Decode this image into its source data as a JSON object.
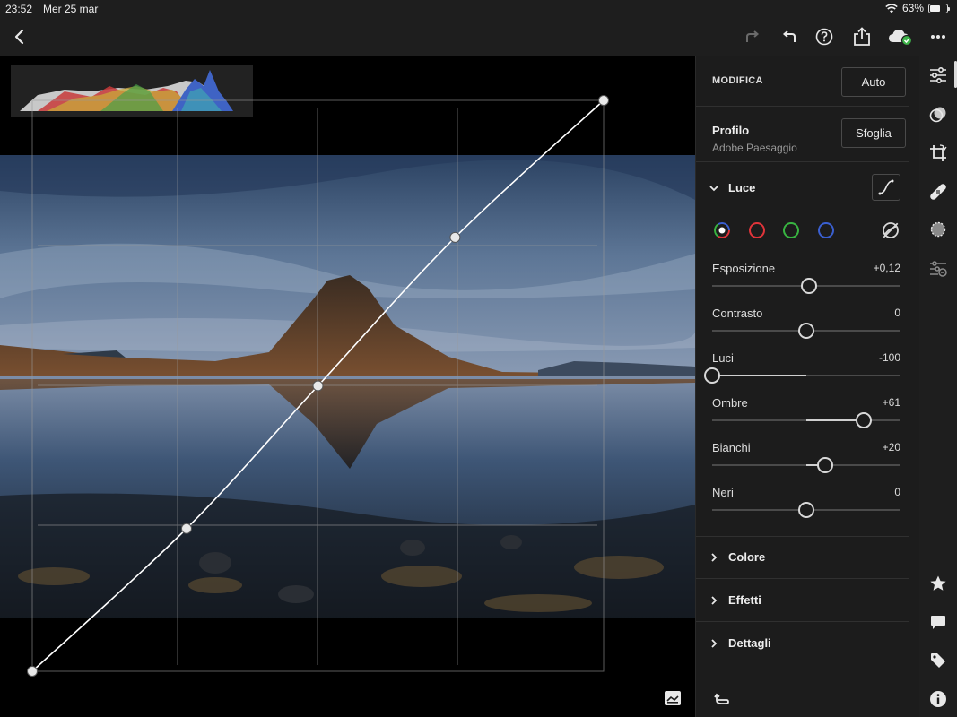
{
  "status_bar": {
    "time": "23:52",
    "date": "Mer 25 mar",
    "battery": "63%",
    "battery_level": 0.63
  },
  "toolbar": {
    "icons": [
      "back-icon",
      "redo-icon",
      "undo-icon",
      "help-icon",
      "share-icon",
      "cloud-sync-icon",
      "more-icon"
    ]
  },
  "canvas": {
    "tone_curve_points": [
      [
        0,
        0
      ],
      [
        0.27,
        0.25
      ],
      [
        0.5,
        0.5
      ],
      [
        0.74,
        0.76
      ],
      [
        1,
        1
      ]
    ]
  },
  "panel": {
    "header": "MODIFICA",
    "auto_label": "Auto",
    "profile": {
      "title": "Profilo",
      "value": "Adobe Paesaggio",
      "browse_label": "Sfoglia"
    },
    "light": {
      "title": "Luce",
      "channels": [
        {
          "name": "rgb-channel-icon",
          "color": "#ffffff"
        },
        {
          "name": "red-channel-icon",
          "color": "#e0343a"
        },
        {
          "name": "green-channel-icon",
          "color": "#38b441"
        },
        {
          "name": "blue-channel-icon",
          "color": "#3a5fd0"
        }
      ],
      "sliders": [
        {
          "id": "esposizione",
          "label": "Esposizione",
          "value_text": "+0,12",
          "value": 0.12,
          "min": -5,
          "max": 5
        },
        {
          "id": "contrasto",
          "label": "Contrasto",
          "value_text": "0",
          "value": 0,
          "min": -100,
          "max": 100
        },
        {
          "id": "luci",
          "label": "Luci",
          "value_text": "-100",
          "value": -100,
          "min": -100,
          "max": 100
        },
        {
          "id": "ombre",
          "label": "Ombre",
          "value_text": "+61",
          "value": 61,
          "min": -100,
          "max": 100
        },
        {
          "id": "bianchi",
          "label": "Bianchi",
          "value_text": "+20",
          "value": 20,
          "min": -100,
          "max": 100
        },
        {
          "id": "neri",
          "label": "Neri",
          "value_text": "0",
          "value": 0,
          "min": -100,
          "max": 100
        }
      ]
    },
    "groups": [
      {
        "id": "colore",
        "label": "Colore"
      },
      {
        "id": "effetti",
        "label": "Effetti"
      },
      {
        "id": "dettagli",
        "label": "Dettagli"
      }
    ]
  },
  "rail": {
    "icons": [
      "edit-sliders-icon",
      "presets-icon",
      "crop-icon",
      "healing-icon",
      "masking-icon",
      "selective-icon",
      "rating-icon",
      "comment-icon",
      "tag-icon",
      "info-icon"
    ]
  }
}
